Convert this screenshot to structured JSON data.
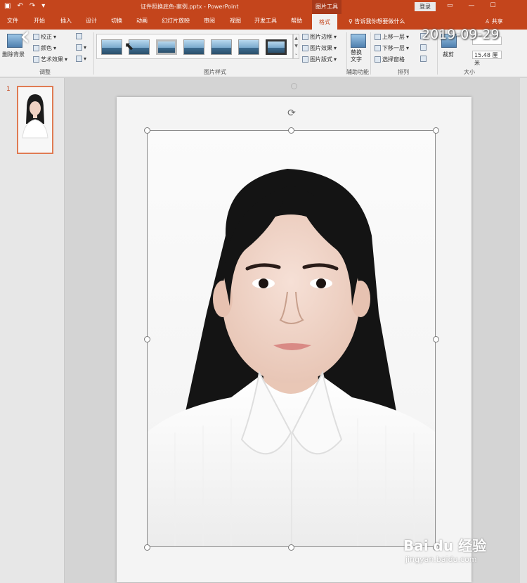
{
  "titlebar": {
    "doc_title": "证件照换底色-案例.pptx - PowerPoint",
    "tools_label": "图片工具",
    "login": "登录"
  },
  "tabs": [
    "文件",
    "开始",
    "插入",
    "设计",
    "切换",
    "动画",
    "幻灯片放映",
    "审阅",
    "视图",
    "开发工具",
    "帮助",
    "格式"
  ],
  "active_tab": "格式",
  "tell_me": "告诉我你想要做什么",
  "share": "共享",
  "ribbon": {
    "remove_bg": "删除背景",
    "corrections": "校正",
    "color": "颜色",
    "artistic": "艺术效果",
    "adjust_group": "调整",
    "picture_border": "图片边框",
    "picture_effects": "图片效果",
    "picture_layout": "图片版式",
    "styles_group": "图片样式",
    "alt_text": "替换文字",
    "accessibility_group": "辅助功能",
    "bring_forward": "上移一层",
    "send_backward": "下移一层",
    "selection_pane": "选择窗格",
    "arrange_group": "排列",
    "crop": "裁剪",
    "width_value": "15.48 厘米",
    "size_group": "大小"
  },
  "overlay": {
    "timestamp": "2019-09-29",
    "back": "‹",
    "watermark_main": "Bai du 经验",
    "watermark_sub": "jingyan.baidu.com"
  },
  "slide_pane": {
    "number": "1"
  },
  "colors": {
    "accent": "#c4451c",
    "ribbon_bg": "#f1f1f1"
  }
}
